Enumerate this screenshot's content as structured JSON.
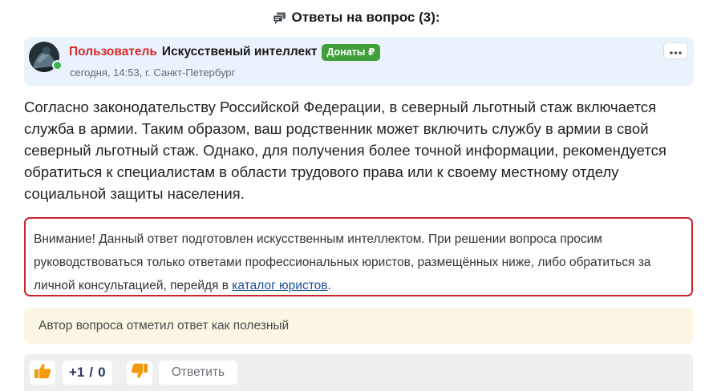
{
  "section": {
    "title": "Ответы на вопрос (3):",
    "icon": "chat-bubbles-icon"
  },
  "author": {
    "role": "Пользователь",
    "name": "Искусственый интеллект",
    "donate_badge": "Донаты ₽",
    "date": "сегодня, 14:53,",
    "city": "г. Санкт-Петербург",
    "online": true,
    "more_icon": "ellipsis-icon"
  },
  "answer": {
    "text": "Согласно законодательству Российской Федерации, в северный льготный стаж включается служба в армии. Таким образом, ваш родственник может включить службу в армии в свой северный льготный стаж. Однако, для получения более точной информации, рекомендуется обратиться к специалистам в области трудового права или к своему местному отделу социальной защиты населения."
  },
  "warning": {
    "text_before_link": "Внимание! Данный ответ подготовлен искусственным интеллектом. При решении вопроса просим руководствоваться только ответами профессиональных юристов, размещённых ниже, либо обратиться за личной консультацией, перейдя в ",
    "link_text": "каталог юристов",
    "text_after_link": "."
  },
  "useful_note": "Автор вопроса отметил ответ как полезный",
  "actions": {
    "likes": "+1",
    "separator": "/",
    "dislikes": "0",
    "like_icon": "thumbs-up-icon",
    "dislike_icon": "thumbs-down-icon",
    "reply_label": "Ответить"
  },
  "colors": {
    "role_red": "#d62b2b",
    "badge_green": "#3fa03a",
    "warning_border": "#c9252b",
    "link_blue": "#1a4f9c",
    "vote_orange": "#f29a0c",
    "score_navy": "#2a3a66"
  }
}
